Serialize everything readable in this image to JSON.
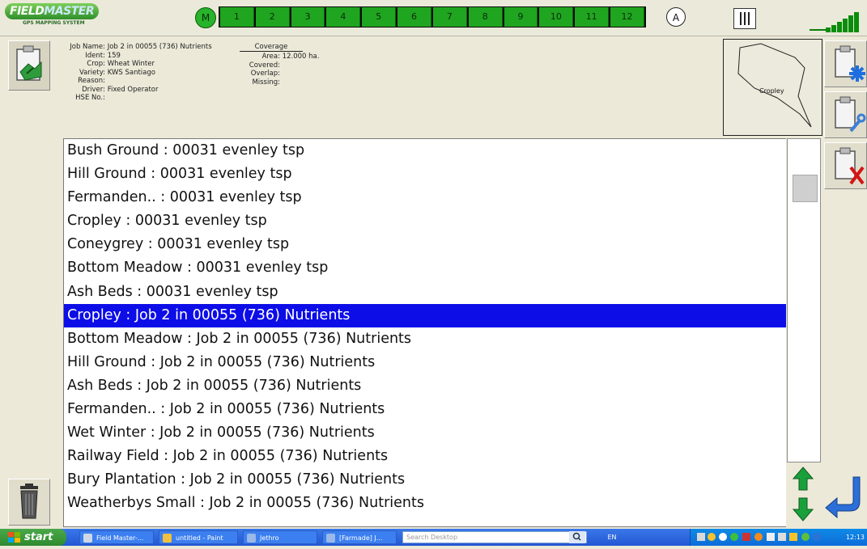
{
  "app": {
    "logo_text_a": "FIELD",
    "logo_text_b": "MASTER",
    "logo_tagline": "GPS MAPPING SYSTEM"
  },
  "topbar": {
    "mode_m": "M",
    "mode_a": "A",
    "sections": [
      "1",
      "2",
      "3",
      "4",
      "5",
      "6",
      "7",
      "8",
      "9",
      "10",
      "11",
      "12"
    ]
  },
  "job": {
    "fields": [
      {
        "key": "Job Name:",
        "value": "Job 2 in 00055 (736) Nutrients"
      },
      {
        "key": "Ident:",
        "value": "159"
      },
      {
        "key": "Crop:",
        "value": "Wheat Winter"
      },
      {
        "key": "Variety:",
        "value": "KWS Santiago"
      },
      {
        "key": "Reason:",
        "value": ""
      },
      {
        "key": "Driver:",
        "value": "Fixed Operator"
      },
      {
        "key": "HSE No.:",
        "value": ""
      }
    ]
  },
  "coverage": {
    "title": "Coverage",
    "fields": [
      {
        "key": "Area:",
        "value": "12.000 ha."
      },
      {
        "key": "Covered:",
        "value": ""
      },
      {
        "key": "Overlap:",
        "value": ""
      },
      {
        "key": "Missing:",
        "value": ""
      }
    ]
  },
  "map": {
    "field_label": "Cropley"
  },
  "list": {
    "selected_index": 7,
    "items": [
      "Bush Ground : 00031 evenley tsp",
      "Hill Ground : 00031 evenley tsp",
      "Fermanden.. : 00031 evenley tsp",
      "Cropley : 00031 evenley tsp",
      "Coneygrey : 00031 evenley tsp",
      "Bottom Meadow : 00031 evenley tsp",
      "Ash Beds : 00031 evenley tsp",
      "Cropley : Job 2 in 00055 (736) Nutrients",
      "Bottom Meadow : Job 2 in 00055 (736) Nutrients",
      "Hill Ground : Job 2 in 00055 (736) Nutrients",
      "Ash Beds : Job 2 in 00055 (736) Nutrients",
      "Fermanden.. : Job 2 in 00055 (736) Nutrients",
      "Wet Winter : Job 2 in 00055 (736) Nutrients",
      "Railway Field : Job 2 in 00055 (736) Nutrients",
      "Bury Plantation : Job 2 in 00055 (736) Nutrients",
      "Weatherbys Small : Job 2 in 00055 (736) Nutrients"
    ]
  },
  "taskbar": {
    "start": "start",
    "tasks": [
      "Field Master-...",
      "untitled - Paint",
      "Jethro",
      "[Farmade] J..."
    ],
    "search_placeholder": "Search Desktop",
    "lang": "EN",
    "clock": "12:13"
  },
  "colors": {
    "selection": "#0d0de8",
    "section_green": "#1fa51f",
    "taskbar_blue": "#2356d3"
  }
}
